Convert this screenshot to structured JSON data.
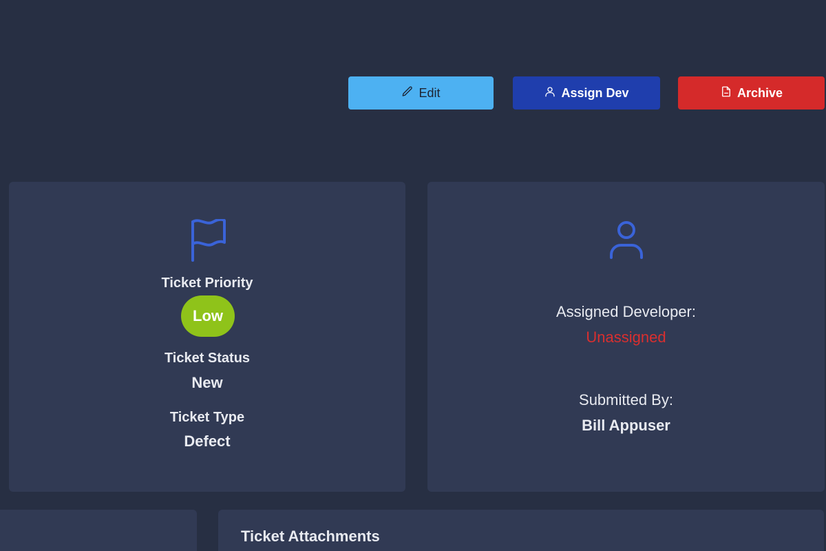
{
  "toolbar": {
    "edit_label": "Edit",
    "assign_label": "Assign Dev",
    "archive_label": "Archive",
    "colors": {
      "edit": "#4db1f2",
      "assign": "#1f3ead",
      "archive": "#d52a2a"
    }
  },
  "ticket_info": {
    "priority_label": "Ticket Priority",
    "priority_value": "Low",
    "priority_color": "#8fc31a",
    "status_label": "Ticket Status",
    "status_value": "New",
    "type_label": "Ticket Type",
    "type_value": "Defect"
  },
  "developer": {
    "assigned_label": "Assigned Developer:",
    "assigned_value": "Unassigned",
    "assigned_color": "#d92f2f",
    "submitted_label": "Submitted By:",
    "submitted_value": "Bill Appuser"
  },
  "attachments": {
    "title": "Ticket Attachments"
  },
  "icons": {
    "edit": "pencil-icon",
    "assign": "user-icon",
    "archive": "file-icon",
    "priority": "flag-icon",
    "developer": "user-icon"
  }
}
